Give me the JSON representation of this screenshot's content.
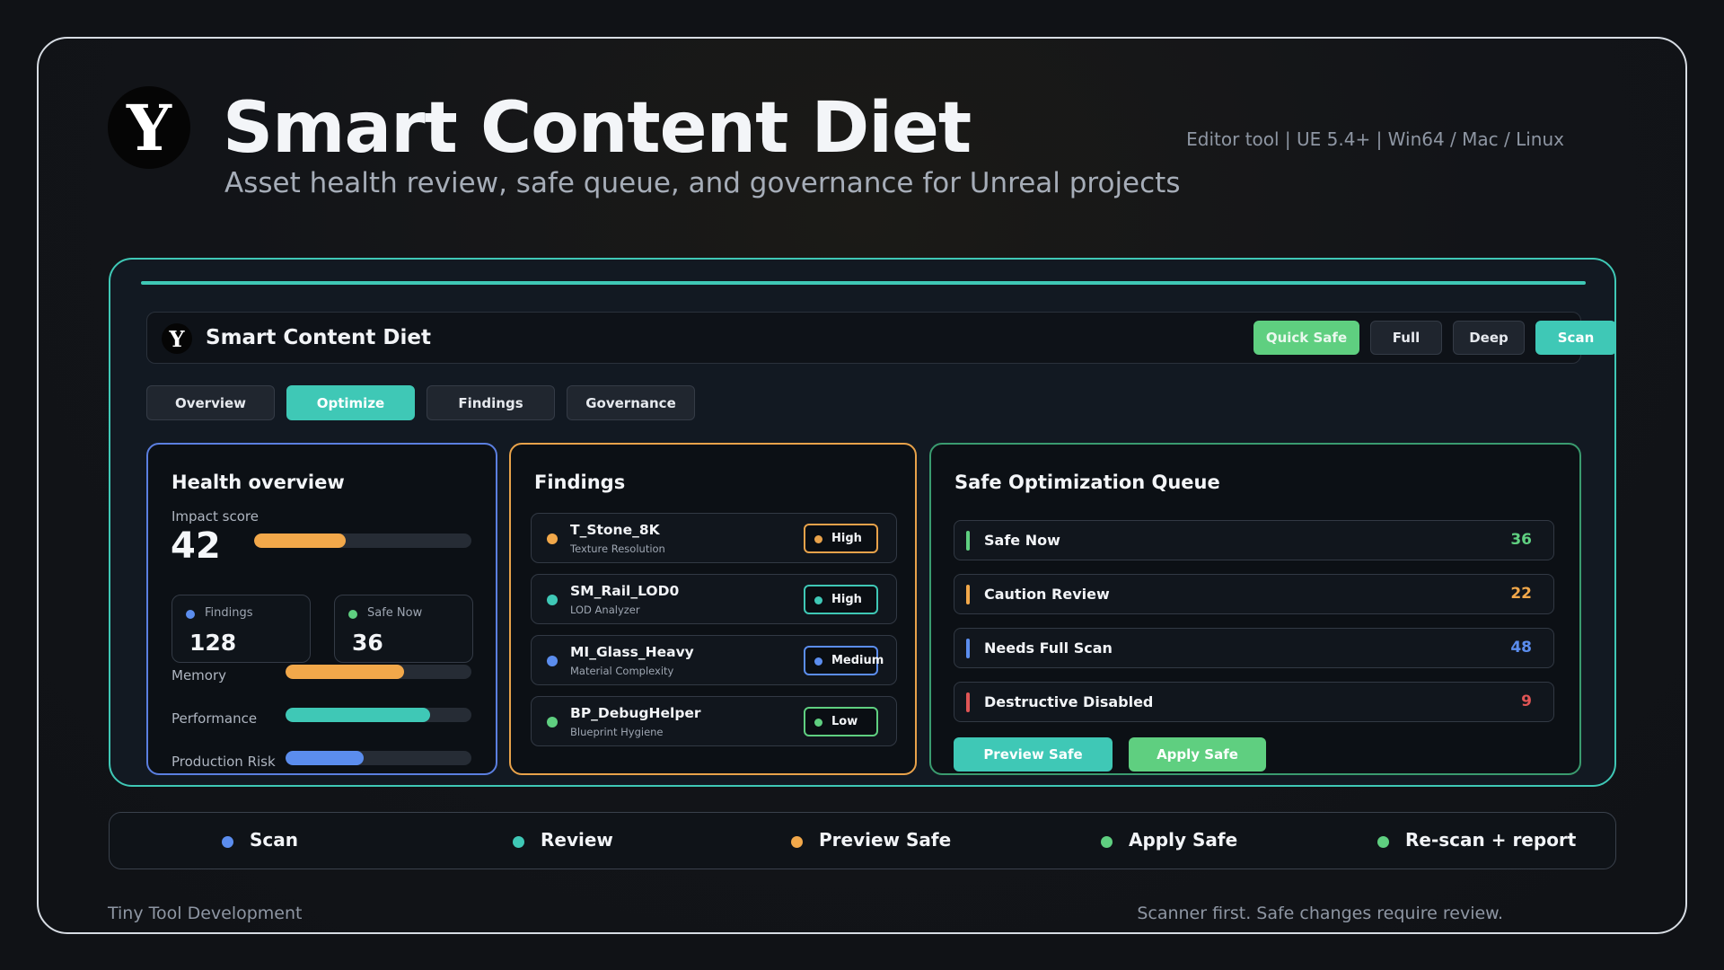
{
  "header": {
    "logo_letter": "Y",
    "title": "Smart Content Diet",
    "subtitle": "Asset health review, safe queue, and governance for Unreal projects",
    "meta": "Editor tool  |  UE 5.4+  |  Win64 / Mac / Linux"
  },
  "app": {
    "logo_letter": "Y",
    "title": "Smart Content Diet",
    "toolbar": {
      "quick_safe": "Quick Safe",
      "full": "Full",
      "deep": "Deep",
      "scan": "Scan"
    },
    "tabs": [
      {
        "label": "Overview",
        "active": false
      },
      {
        "label": "Optimize",
        "active": true
      },
      {
        "label": "Findings",
        "active": false
      },
      {
        "label": "Governance",
        "active": false
      }
    ],
    "health": {
      "title": "Health overview",
      "impact_label": "Impact score",
      "impact_value": "42",
      "impact_fraction": 0.42,
      "stats": [
        {
          "label": "Findings",
          "value": "128",
          "color": "#5b8dee"
        },
        {
          "label": "Safe Now",
          "value": "36",
          "color": "#5fcf80"
        }
      ],
      "metrics": [
        {
          "label": "Memory",
          "fraction": 0.64,
          "color": "#f2a84a"
        },
        {
          "label": "Performance",
          "fraction": 0.78,
          "color": "#3fc8b6"
        },
        {
          "label": "Production Risk",
          "fraction": 0.42,
          "color": "#5b8dee"
        }
      ]
    },
    "findings": {
      "title": "Findings",
      "items": [
        {
          "name": "T_Stone_8K",
          "category": "Texture Resolution",
          "severity": "High",
          "dot_color": "#f2a84a",
          "badge_color": "#e8a24a"
        },
        {
          "name": "SM_Rail_LOD0",
          "category": "LOD Analyzer",
          "severity": "High",
          "dot_color": "#3fc8b6",
          "badge_color": "#3fc8b6"
        },
        {
          "name": "MI_Glass_Heavy",
          "category": "Material Complexity",
          "severity": "Medium",
          "dot_color": "#5b8dee",
          "badge_color": "#5b8dee"
        },
        {
          "name": "BP_DebugHelper",
          "category": "Blueprint Hygiene",
          "severity": "Low",
          "dot_color": "#5fcf80",
          "badge_color": "#5fcf80"
        }
      ]
    },
    "queue": {
      "title": "Safe Optimization Queue",
      "items": [
        {
          "label": "Safe Now",
          "count": "36",
          "color": "#5fcf80"
        },
        {
          "label": "Caution Review",
          "count": "22",
          "color": "#f2a84a"
        },
        {
          "label": "Needs Full Scan",
          "count": "48",
          "color": "#5b8dee"
        },
        {
          "label": "Destructive Disabled",
          "count": "9",
          "color": "#e05555"
        }
      ],
      "preview_label": "Preview Safe",
      "apply_label": "Apply Safe"
    }
  },
  "flow": [
    {
      "label": "Scan",
      "color": "#5b8dee"
    },
    {
      "label": "Review",
      "color": "#3fc8b6"
    },
    {
      "label": "Preview Safe",
      "color": "#f2a84a"
    },
    {
      "label": "Apply Safe",
      "color": "#5fcf80"
    },
    {
      "label": "Re-scan + report",
      "color": "#5fcf80"
    }
  ],
  "footer": {
    "left": "Tiny Tool Development",
    "right": "Scanner first. Safe changes require review."
  },
  "colors": {
    "accent": "#3fc8b6",
    "green": "#5fcf80",
    "orange": "#f2a84a",
    "blue": "#5b8dee",
    "red": "#e05555"
  }
}
